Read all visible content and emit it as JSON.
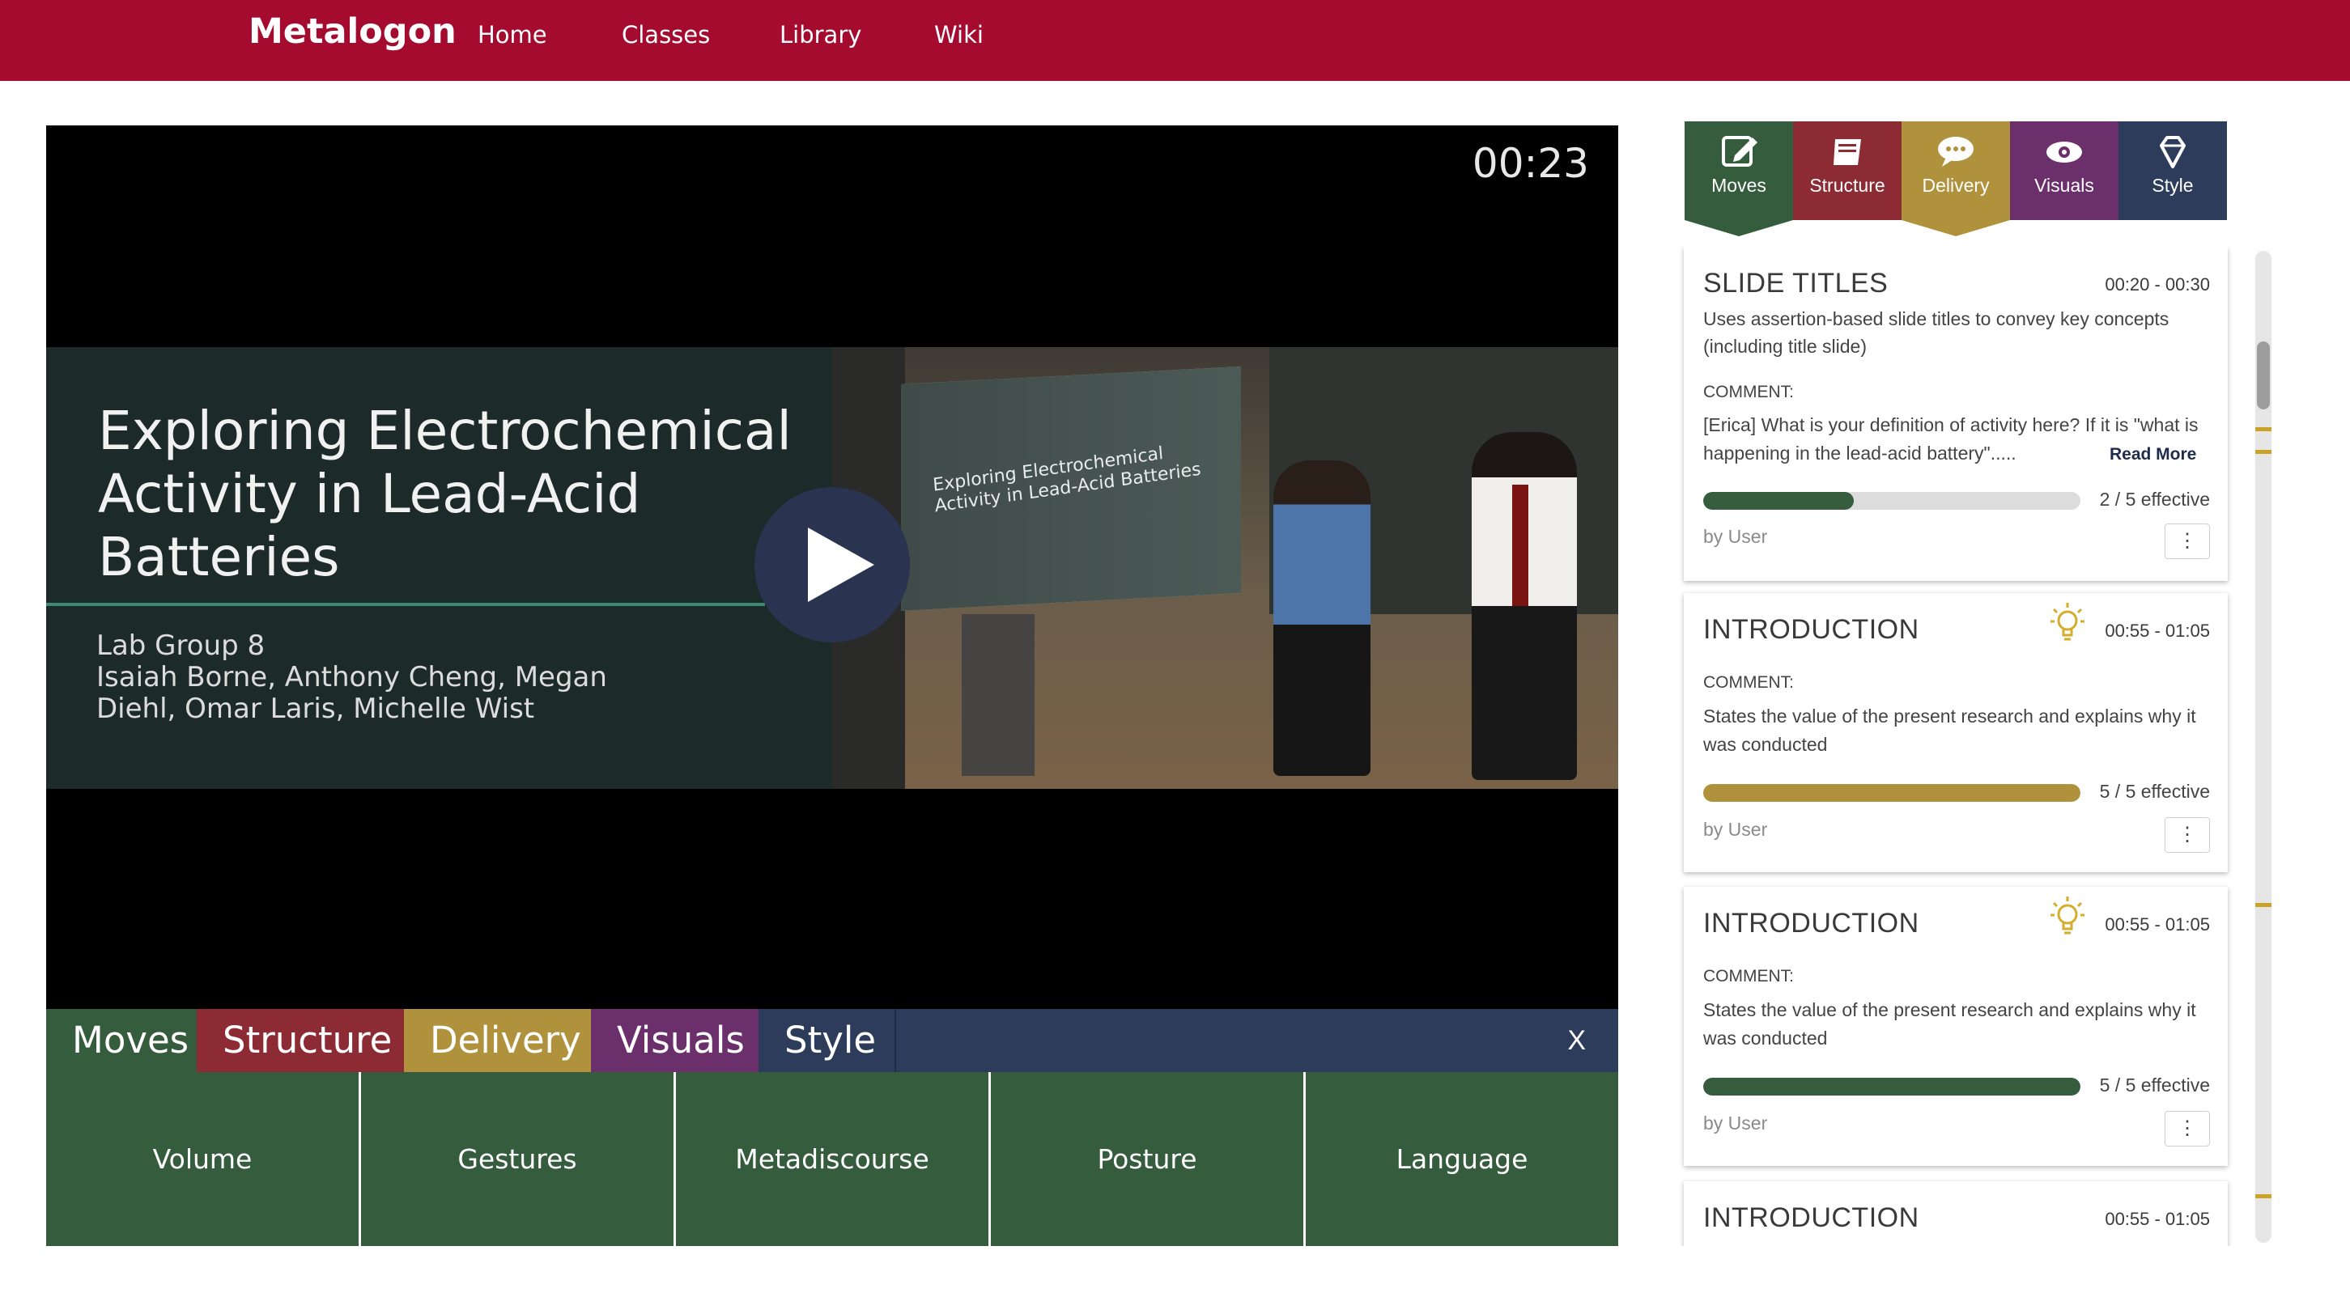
{
  "nav": {
    "brand": "Metalogon",
    "links": [
      "Home",
      "Classes",
      "Library",
      "Wiki"
    ]
  },
  "video": {
    "timer": "00:23",
    "slide_title": "Exploring Electrochemical Activity in Lead-Acid Batteries",
    "slide_authors": "Lab Group 8\nIsaiah Borne, Anthony Cheng, Megan\nDiehl, Omar Laris, Michelle Wist",
    "screen_text": "Exploring Electrochemical Activity in Lead-Acid Batteries"
  },
  "categories": {
    "tabs": [
      "Moves",
      "Structure",
      "Delivery",
      "Visuals",
      "Style"
    ],
    "close": "X",
    "items": [
      "Volume",
      "Gestures",
      "Metadiscourse",
      "Posture",
      "Language"
    ]
  },
  "right_tabs": [
    {
      "label": "Moves",
      "icon": "edit-icon",
      "color": "#345c3d"
    },
    {
      "label": "Structure",
      "icon": "book-icon",
      "color": "#8c2b33"
    },
    {
      "label": "Delivery",
      "icon": "speech-bubble-icon",
      "color": "#b0913c"
    },
    {
      "label": "Visuals",
      "icon": "eye-icon",
      "color": "#6b2f6c"
    },
    {
      "label": "Style",
      "icon": "diamond-icon",
      "color": "#2c3c5a"
    }
  ],
  "colors": {
    "brand": "#a50a2f",
    "moves": "#345c3d",
    "structure": "#8c2b33",
    "delivery": "#b0913c",
    "visuals": "#6b2f6c",
    "style": "#2c3c5a"
  },
  "cards": [
    {
      "title": "SLIDE TITLES",
      "time": "00:20 - 00:30",
      "description": "Uses assertion-based slide titles to convey key concepts (including title slide)",
      "comment_label": "COMMENT:",
      "comment": "[Erica] What is your definition of activity here? If it is \"what is happening in the lead-acid battery\".....",
      "read_more": "Read More",
      "effective": "2 / 5 effective",
      "score": 2,
      "max": 5,
      "by": "by User",
      "kebab": "⋮"
    },
    {
      "title": "INTRODUCTION",
      "time": "00:55 - 01:05",
      "comment_label": "COMMENT:",
      "comment": "States the value of the present research and explains why it was conducted",
      "effective": "5 / 5 effective",
      "score": 5,
      "max": 5,
      "by": "by User",
      "kebab": "⋮"
    },
    {
      "title": "INTRODUCTION",
      "time": "00:55 - 01:05",
      "comment_label": "COMMENT:",
      "comment": "States the value of the present research and explains why it was conducted",
      "effective": "5 / 5 effective",
      "score": 5,
      "max": 5,
      "by": "by User",
      "kebab": "⋮"
    },
    {
      "title": "INTRODUCTION",
      "time": "00:55 - 01:05"
    }
  ]
}
